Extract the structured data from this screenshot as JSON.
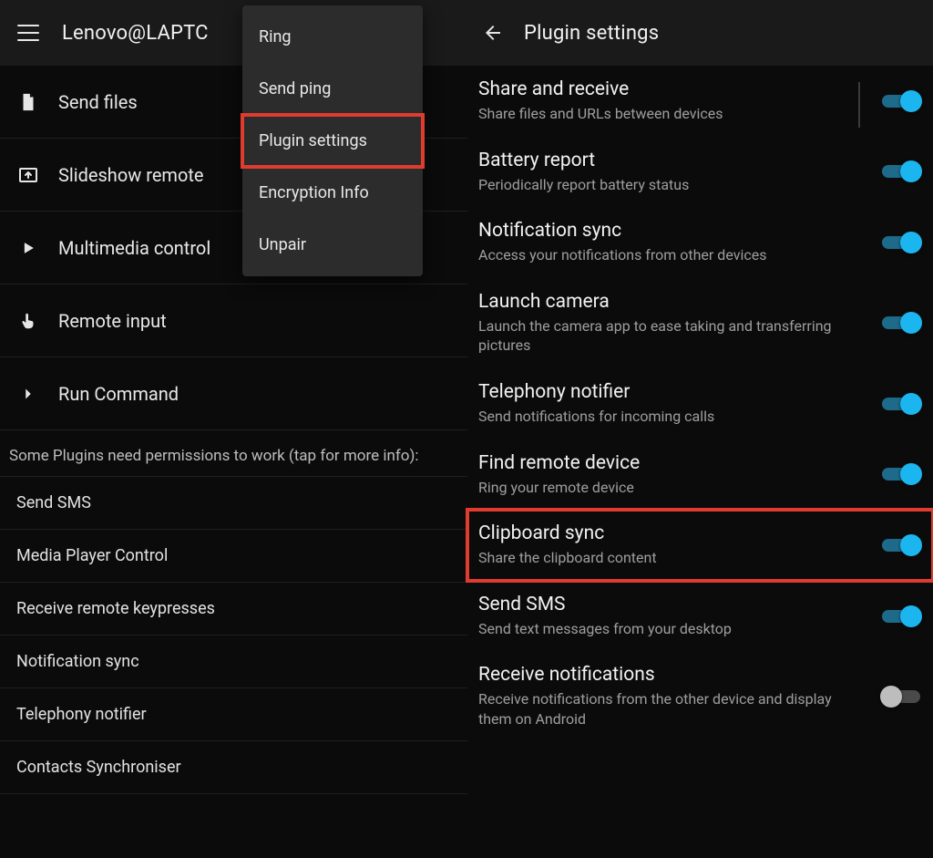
{
  "left": {
    "appbar_title": "Lenovo@LAPTC",
    "actions": [
      {
        "label": "Send files"
      },
      {
        "label": "Slideshow remote"
      },
      {
        "label": "Multimedia control"
      },
      {
        "label": "Remote input"
      },
      {
        "label": "Run Command"
      }
    ],
    "permissions_header": "Some Plugins need permissions to work (tap for more info):",
    "permissions": [
      "Send SMS",
      "Media Player Control",
      "Receive remote keypresses",
      "Notification sync",
      "Telephony notifier",
      "Contacts Synchroniser"
    ],
    "popup": [
      {
        "label": "Ring",
        "highlight": false
      },
      {
        "label": "Send ping",
        "highlight": false
      },
      {
        "label": "Plugin settings",
        "highlight": true
      },
      {
        "label": "Encryption Info",
        "highlight": false
      },
      {
        "label": "Unpair",
        "highlight": false
      }
    ]
  },
  "right": {
    "appbar_title": "Plugin settings",
    "items": [
      {
        "title": "Share and receive",
        "subtitle": "Share files and URLs between devices",
        "on": true,
        "highlight": false
      },
      {
        "title": "Battery report",
        "subtitle": "Periodically report battery status",
        "on": true,
        "highlight": false
      },
      {
        "title": "Notification sync",
        "subtitle": "Access your notifications from other devices",
        "on": true,
        "highlight": false
      },
      {
        "title": "Launch camera",
        "subtitle": "Launch the camera app to ease taking and transferring pictures",
        "on": true,
        "highlight": false
      },
      {
        "title": "Telephony notifier",
        "subtitle": "Send notifications for incoming calls",
        "on": true,
        "highlight": false
      },
      {
        "title": "Find remote device",
        "subtitle": "Ring your remote device",
        "on": true,
        "highlight": false
      },
      {
        "title": "Clipboard sync",
        "subtitle": "Share the clipboard content",
        "on": true,
        "highlight": true
      },
      {
        "title": "Send SMS",
        "subtitle": "Send text messages from your desktop",
        "on": true,
        "highlight": false
      },
      {
        "title": "Receive notifications",
        "subtitle": "Receive notifications from the other device and display them on Android",
        "on": false,
        "highlight": false
      }
    ]
  }
}
